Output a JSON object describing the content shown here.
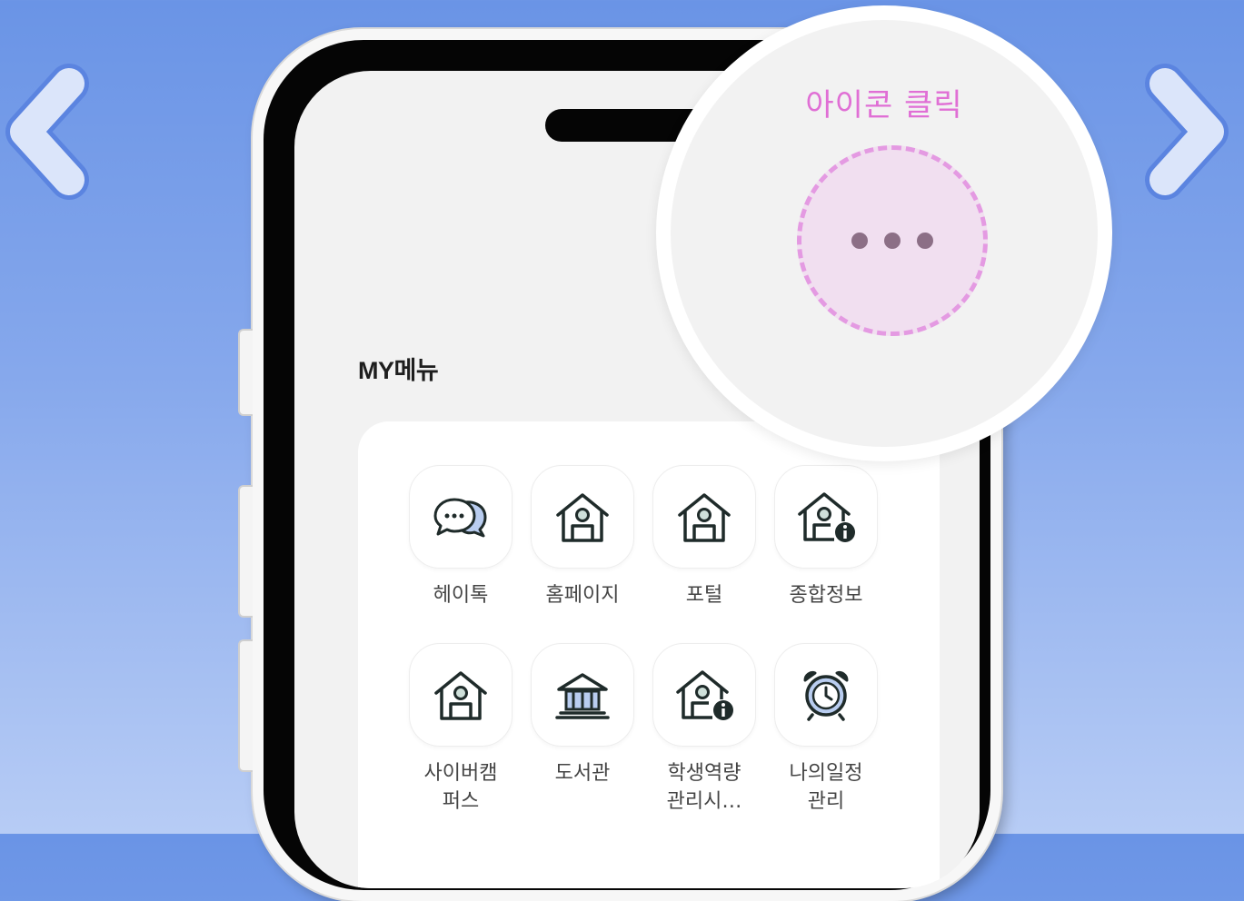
{
  "colors": {
    "accent": "#e06fd5",
    "dashed_ring": "#e49ae2",
    "highlight_fill": "#f1dff0",
    "icon_stroke": "#1f2b2a",
    "icon_fill": "#cfe0da"
  },
  "navigation": {
    "prev_icon": "chevron-left-icon",
    "next_icon": "chevron-right-icon"
  },
  "callout": {
    "label": "아이콘 클릭",
    "button_icon": "more-dots-icon"
  },
  "my_menu": {
    "title": "MY메뉴",
    "items": [
      {
        "label": "헤이톡",
        "icon": "chat-bubbles-icon"
      },
      {
        "label": "홈페이지",
        "icon": "house-icon"
      },
      {
        "label": "포털",
        "icon": "house-icon"
      },
      {
        "label": "종합정보",
        "icon": "house-info-icon"
      },
      {
        "label": "사이버캠\n퍼스",
        "icon": "house-icon"
      },
      {
        "label": "도서관",
        "icon": "library-icon"
      },
      {
        "label": "학생역량\n관리시…",
        "icon": "house-info-icon"
      },
      {
        "label": "나의일정\n관리",
        "icon": "alarm-clock-icon"
      }
    ]
  }
}
